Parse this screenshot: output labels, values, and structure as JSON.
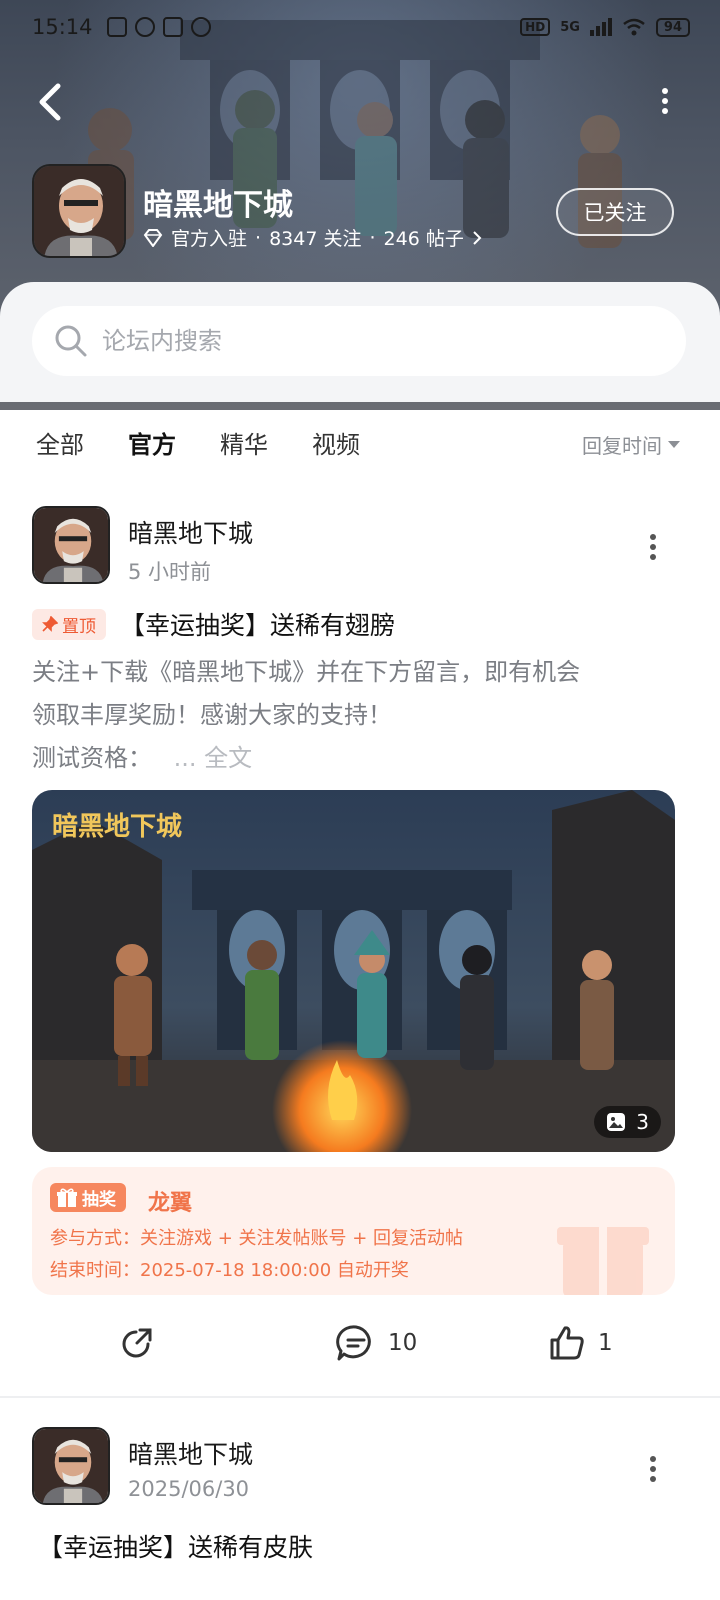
{
  "status_bar": {
    "time": "15:14",
    "hd": "HD",
    "network": "5G",
    "battery": "94"
  },
  "forum": {
    "title": "暗黑地下城",
    "official_label": "官方入驻",
    "followers": "8347 关注",
    "posts": "246 帖子",
    "follow_button": "已关注"
  },
  "search": {
    "placeholder": "论坛内搜索"
  },
  "tabs": [
    {
      "label": "全部",
      "active": false
    },
    {
      "label": "官方",
      "active": true
    },
    {
      "label": "精华",
      "active": false
    },
    {
      "label": "视频",
      "active": false
    }
  ],
  "sort_label": "回复时间",
  "posts": [
    {
      "author": "暗黑地下城",
      "time": "5 小时前",
      "pin_label": "置顶",
      "title": "【幸运抽奖】送稀有翅膀",
      "body_line1": "关注+下载《暗黑地下城》并在下方留言，即有机会",
      "body_line2": "领取丰厚奖励！感谢大家的支持！",
      "body_line3": "测试资格：",
      "more_label": "... 全文",
      "image_caption": "暗黑地下城",
      "image_count": "3",
      "lottery": {
        "tag": "抽奖",
        "prize": "龙翼",
        "method": "参与方式：关注游戏 + 关注发帖账号 + 回复活动帖",
        "end_time": "结束时间：2025-07-18 18:00:00 自动开奖"
      },
      "comments": "10",
      "likes": "1"
    },
    {
      "author": "暗黑地下城",
      "time": "2025/06/30",
      "title": "【幸运抽奖】送稀有皮肤"
    }
  ],
  "colors": {
    "accent": "#2ac6b7",
    "lottery": "#f0744a",
    "pin": "#ee5a33"
  }
}
